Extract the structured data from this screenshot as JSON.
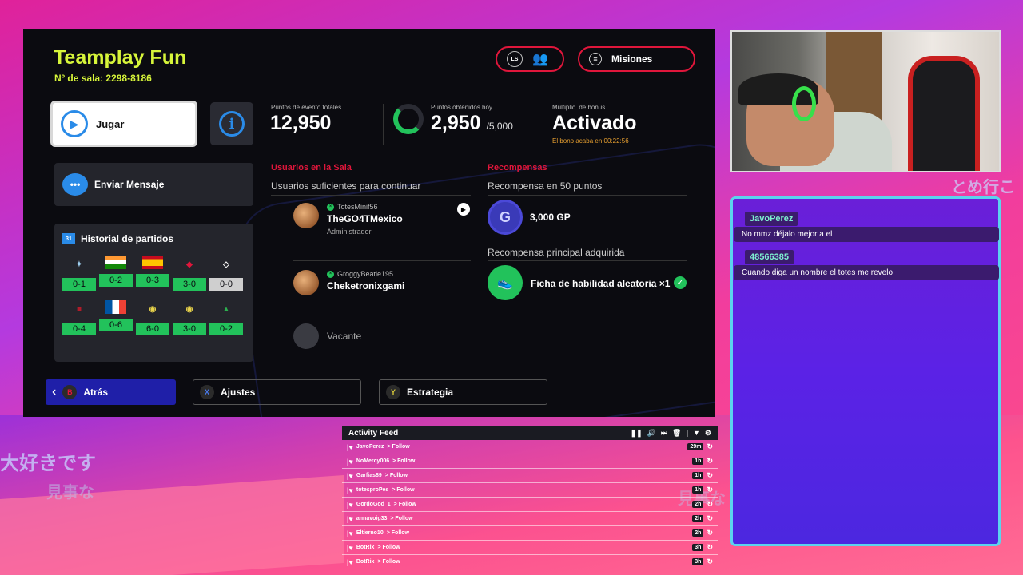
{
  "room": {
    "title": "Teamplay Fun",
    "room_number": "Nº de sala: 2298-8186",
    "ls_icon_label": "LS",
    "missions_label": "Misiones"
  },
  "actions": {
    "play_label": "Jugar",
    "send_message_label": "Enviar Mensaje",
    "back_label": "Atrás",
    "settings_label": "Ajustes",
    "strategy_label": "Estrategia",
    "back_key": "B",
    "settings_key": "X",
    "strategy_key": "Y"
  },
  "history": {
    "title": "Historial de partidos",
    "matches": [
      {
        "crest": "lazio-crest",
        "score": "0-1",
        "result": "win"
      },
      {
        "crest": "india-flag",
        "score": "0-2",
        "result": "win"
      },
      {
        "crest": "spain-flag",
        "score": "0-3",
        "result": "win"
      },
      {
        "crest": "chivas-crest",
        "score": "3-0",
        "result": "win"
      },
      {
        "crest": "river-plate-crest",
        "score": "0-0",
        "result": "draw"
      },
      {
        "crest": "club-crest",
        "score": "0-4",
        "result": "win"
      },
      {
        "crest": "france-flag",
        "score": "0-6",
        "result": "win"
      },
      {
        "crest": "america-crest",
        "score": "6-0",
        "result": "win"
      },
      {
        "crest": "america-crest",
        "score": "3-0",
        "result": "win"
      },
      {
        "crest": "sporting-crest",
        "score": "0-2",
        "result": "win"
      }
    ]
  },
  "stats": {
    "total_points_label": "Puntos de evento totales",
    "total_points": "12,950",
    "today_points_label": "Puntos obtenidos hoy",
    "today_points": "2,950",
    "today_points_max": "/5,000",
    "today_progress": 0.59,
    "bonus_label": "Multiplic. de bonus",
    "bonus_value": "Activado",
    "bonus_sub": "El bono acaba en 00:22:56"
  },
  "users": {
    "title": "Usuarios en la Sala",
    "subtitle": "Usuarios suficientes para continuar",
    "list": [
      {
        "gamertag": "TotesMinif56",
        "name": "TheGO4TMexico",
        "role": "Administrador"
      },
      {
        "gamertag": "GroggyBeatle195",
        "name": "Cheketronixgami",
        "role": ""
      },
      {
        "gamertag": "",
        "name": "Vacante",
        "role": ""
      }
    ]
  },
  "rewards": {
    "title": "Recompensas",
    "sub1": "Recompensa en 50 puntos",
    "reward1": "3,000 GP",
    "gp_icon_letter": "G",
    "sub2": "Recompensa principal adquirida",
    "reward2": "Ficha de habilidad aleatoria ×1"
  },
  "decor": {
    "jp1": "大好きです",
    "jp2": "見事な",
    "jp3": "見事な",
    "jp4": "とめ行こ"
  },
  "chat": {
    "messages": [
      {
        "user": "JavoPerez",
        "text": "No mmz déjalo mejor a el"
      },
      {
        "user": "48566385",
        "text": "Cuando diga un nombre el totes me revelo"
      }
    ]
  },
  "feed": {
    "title": "Activity Feed",
    "items": [
      {
        "user": "JavoPerez",
        "action": "> Follow",
        "time": "29m"
      },
      {
        "user": "NoMercy006",
        "action": "> Follow",
        "time": "1h"
      },
      {
        "user": "Garfias89",
        "action": "> Follow",
        "time": "1h"
      },
      {
        "user": "totesproPes",
        "action": "> Follow",
        "time": "1h"
      },
      {
        "user": "GordoGod_1",
        "action": "> Follow",
        "time": "2h"
      },
      {
        "user": "annavoig33",
        "action": "> Follow",
        "time": "2h"
      },
      {
        "user": "Eltierno10",
        "action": "> Follow",
        "time": "2h"
      },
      {
        "user": "BotRix",
        "action": "> Follow",
        "time": "3h"
      },
      {
        "user": "BotRix",
        "action": "> Follow",
        "time": "3h"
      }
    ]
  },
  "colors": {
    "accent_lime": "#d7f53a",
    "accent_red": "#e0163b",
    "accent_blue": "#2a8be8",
    "win_green": "#22c25b"
  }
}
